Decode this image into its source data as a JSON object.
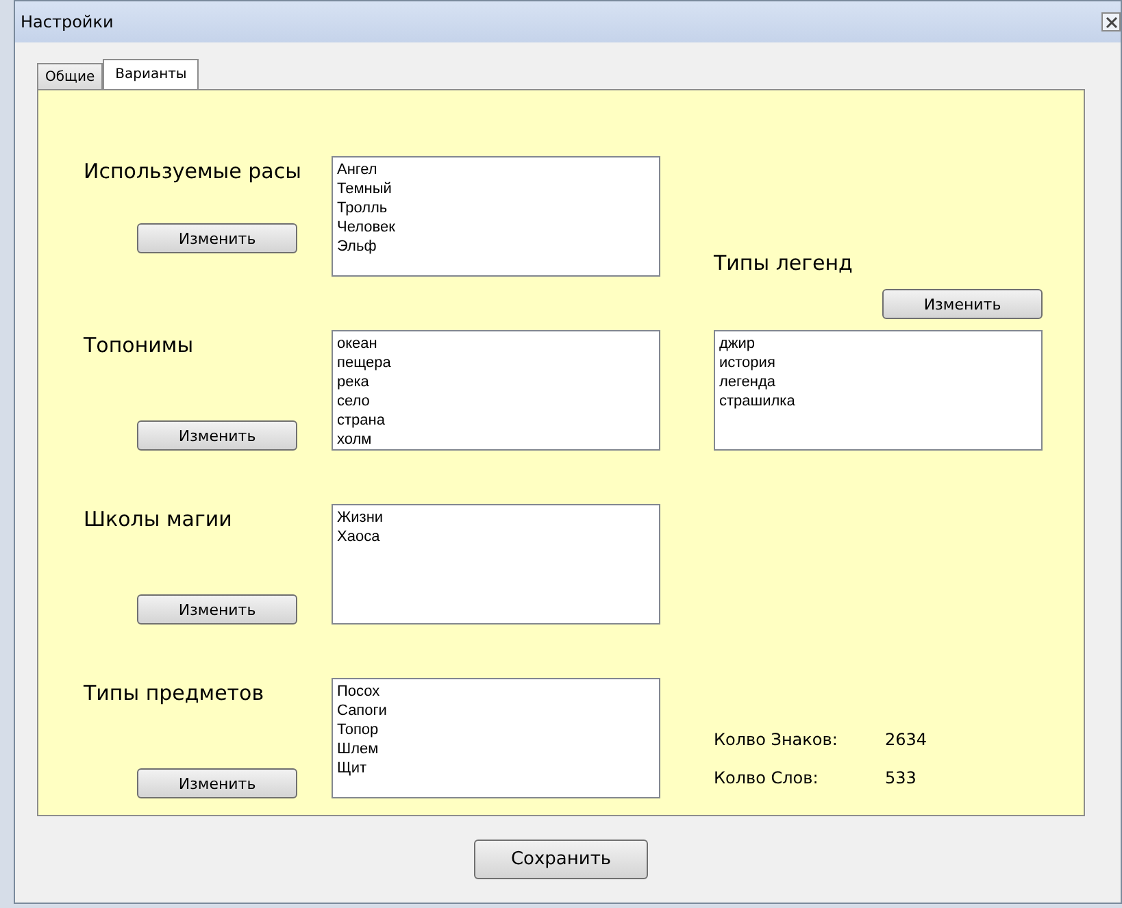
{
  "window": {
    "title": "Настройки"
  },
  "tabs": [
    {
      "label": "Общие",
      "selected": false
    },
    {
      "label": "Варианты",
      "selected": true
    }
  ],
  "sections": [
    {
      "label": "Используемые расы",
      "button": "Изменить",
      "items": [
        "Ангел",
        "Темный",
        "Тролль",
        "Человек",
        "Эльф"
      ]
    },
    {
      "label": "Топонимы",
      "button": "Изменить",
      "items": [
        "океан",
        "пещера",
        "река",
        "село",
        "страна",
        "холм"
      ]
    },
    {
      "label": "Школы магии",
      "button": "Изменить",
      "items": [
        "Жизни",
        "Хаоса"
      ]
    },
    {
      "label": "Типы предметов",
      "button": "Изменить",
      "items": [
        "Посох",
        "Сапоги",
        "Топор",
        "Шлем",
        "Щит"
      ]
    }
  ],
  "legend": {
    "label": "Типы легенд",
    "button": "Изменить",
    "items": [
      "джир",
      "история",
      "легенда",
      "страшилка"
    ]
  },
  "stats": [
    {
      "label": "Колво Знаков:",
      "value": "2634"
    },
    {
      "label": "Колво Слов:",
      "value": "533"
    }
  ],
  "save_button": "Сохранить"
}
